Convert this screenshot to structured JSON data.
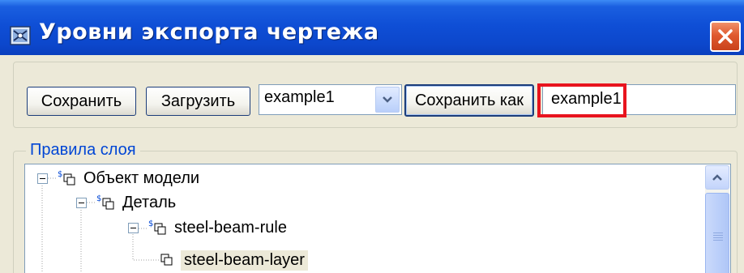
{
  "window": {
    "title": "Уровни экспорта чертежа"
  },
  "toolbar": {
    "save_label": "Сохранить",
    "load_label": "Загрузить",
    "preset_selected": "example1",
    "save_as_label": "Сохранить как",
    "save_as_name": "example1"
  },
  "rules": {
    "legend": "Правила слоя",
    "tree": [
      {
        "label": "Объект модели",
        "level": 0
      },
      {
        "label": "Деталь",
        "level": 1
      },
      {
        "label": "steel-beam-rule",
        "level": 2
      },
      {
        "label": "steel-beam-layer",
        "level": 3
      }
    ]
  },
  "colors": {
    "highlight": "#e8141e",
    "title_bar": "#0f4fd6",
    "legend_text": "#0046d5"
  }
}
